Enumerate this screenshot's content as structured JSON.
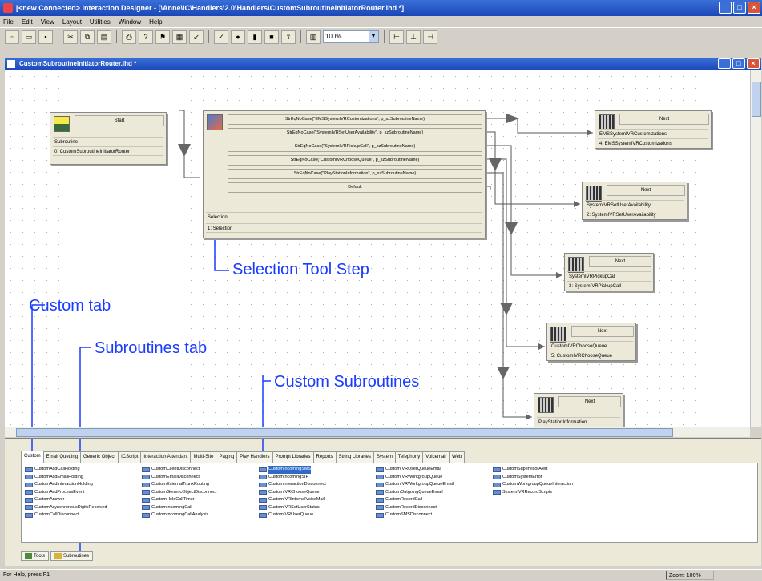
{
  "window": {
    "title": "[<new Connected> Interaction Designer - [\\Anne\\IC\\Handlers\\2.0\\Handlers\\CustomSubroutineInitiatorRouter.ihd *]",
    "doc_title": "CustomSubroutineInitiatorRouter.ihd *"
  },
  "menu": [
    "File",
    "Edit",
    "View",
    "Layout",
    "Utilities",
    "Window",
    "Help"
  ],
  "toolbar": {
    "zoom": "100%"
  },
  "start_node": {
    "header": "Start",
    "row1": "Subroutine",
    "row2": "0: CustomSubroutineInitiatorRouter"
  },
  "selection_node": {
    "rows": [
      "StrEqNoCase(\"EMSSystemIVRCustomizations\", p_szSubroutineName)",
      "StrEqNoCase(\"SystemIVRSetUserAvailability\", p_szSubroutineName)",
      "StrEqNoCase(\"SystemIVRPickupCall\", p_szSubroutineName)",
      "StrEqNoCase(\"CustomIVRChooseQueue\", p_szSubroutineName)",
      "StrEqNoCase(\"PlayStationInformation\", p_szSubroutineName)",
      "Default"
    ],
    "footer1": "Selection",
    "footer2": "1: Selection"
  },
  "next_nodes": [
    {
      "header": "Next",
      "row1": "EMSSystemIVRCustomizations",
      "row2": "4: EMSSystemIVRCustomizations"
    },
    {
      "header": "Next",
      "row1": "SystemIVRSetUserAvailability",
      "row2": "2: SystemIVRSetUserAvailability"
    },
    {
      "header": "Next",
      "row1": "SystemIVRPickupCall",
      "row2": "3: SystemIVRPickupCall"
    },
    {
      "header": "Next",
      "row1": "CustomIVRChooseQueue",
      "row2": "5: CustomIVRChooseQueue"
    },
    {
      "header": "Next",
      "row1": "PlayStationInformation",
      "row2": ""
    }
  ],
  "callouts": {
    "selection_tool_step": "Selection Tool Step",
    "custom_tab": "Custom tab",
    "subroutines_tab": "Subroutines tab",
    "custom_subroutines": "Custom Subroutines"
  },
  "library_tabs": [
    "Custom",
    "Email Queuing",
    "Generic Object",
    "ICScript",
    "Interaction Attendant",
    "Multi-Site",
    "Paging",
    "Play Handlers",
    "Prompt Libraries",
    "Reports",
    "String Libraries",
    "System",
    "Telephony",
    "Voicemail",
    "Web"
  ],
  "library_columns": [
    [
      "CustomAcdCallHolding",
      "CustomAcdEmailHolding",
      "CustomAcdInteractionHolding",
      "CustomAcdProcessEvent",
      "CustomAnswer",
      "CustomAsynchronousDigitsReceived",
      "CustomCallDisconnect"
    ],
    [
      "CustomClientDisconnect",
      "CustomEmailDisconnect",
      "CustomExternalTrunkRouting",
      "CustomGenericObjectDisconnect",
      "CustomHeldCallTimer",
      "CustomIncomingCall",
      "CustomIncomingCallAnalysis"
    ],
    [
      "CustomIncomingSMS",
      "CustomIncomingSIP",
      "CustomInteractionDisconnect",
      "CustomIVRChooseQueue",
      "CustomIVRInternalVoiceMail",
      "CustomIVRSetUserStatus",
      "CustomIVRUserQueue"
    ],
    [
      "CustomIVRUserQueueEmail",
      "CustomIVRWorkgroupQueue",
      "CustomIVRWorkgroupQueueEmail",
      "CustomOutgoingQueueEmail",
      "CustomRecordCall",
      "CustomRecordDisconnect",
      "CustomSMSDisconnect"
    ],
    [
      "CustomSupervisorAlert",
      "CustomSystemError",
      "CustomWorkgroupQueueInteraction",
      "SystemIVRRecordScripts"
    ]
  ],
  "selected_library_item": "CustomIncomingSMS",
  "lower_tabs": [
    "Tools",
    "Subroutines"
  ],
  "status": {
    "left": "For Help, press F1",
    "zoom": "Zoom: 100%"
  }
}
